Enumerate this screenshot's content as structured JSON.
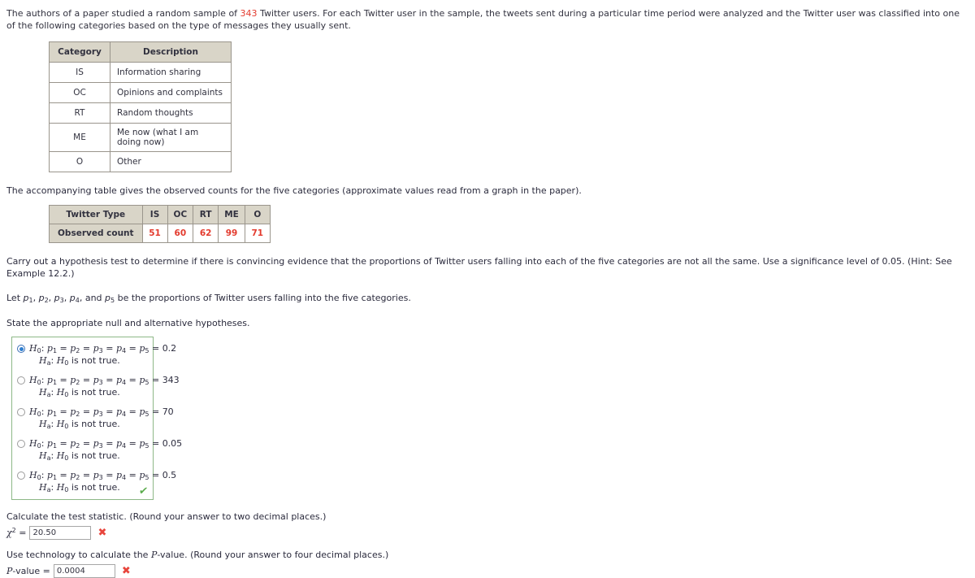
{
  "intro": {
    "part1": "The authors of a paper studied a random sample of ",
    "sample_size": "343",
    "part2": " Twitter users. For each Twitter user in the sample, the tweets sent during a particular time period were analyzed and the Twitter user was classified into one of the following categories based on the type of messages they usually sent."
  },
  "category_table": {
    "headers": [
      "Category",
      "Description"
    ],
    "rows": [
      {
        "category": "IS",
        "description": "Information sharing"
      },
      {
        "category": "OC",
        "description": "Opinions and complaints"
      },
      {
        "category": "RT",
        "description": "Random thoughts"
      },
      {
        "category": "ME",
        "description": "Me now (what I am doing now)"
      },
      {
        "category": "O",
        "description": "Other"
      }
    ]
  },
  "accompanying_text": "The accompanying table gives the observed counts for the five categories (approximate values read from a graph in the paper).",
  "counts_table": {
    "row_header_1": "Twitter Type",
    "row_header_2": "Observed count",
    "columns": [
      "IS",
      "OC",
      "RT",
      "ME",
      "O"
    ],
    "values": [
      "51",
      "60",
      "62",
      "99",
      "71"
    ]
  },
  "instruction": "Carry out a hypothesis test to determine if there is convincing evidence that the proportions of Twitter users falling into each of the five categories are not all the same. Use a significance level of 0.05. (Hint: See Example 12.2.)",
  "let_line": {
    "prefix": "Let ",
    "p1": "p",
    "s1": "1",
    "p2": "p",
    "s2": "2",
    "p3": "p",
    "s3": "3",
    "p4": "p",
    "s4": "4",
    "and": " and ",
    "p5": "p",
    "s5": "5",
    "suffix": " be the proportions of Twitter users falling into the five categories."
  },
  "state_hypotheses": "State the appropriate null and alternative hypotheses.",
  "hypothesis_options": [
    {
      "value": "0.2",
      "selected": true,
      "alt": "is not true."
    },
    {
      "value": "343",
      "selected": false,
      "alt": "is not true."
    },
    {
      "value": "70",
      "selected": false,
      "alt": "is not true."
    },
    {
      "value": "0.05",
      "selected": false,
      "alt": "is not true."
    },
    {
      "value": "0.5",
      "selected": false,
      "alt": "is not true."
    }
  ],
  "hypothesis_template": {
    "null_prefix": "H",
    "null_sub": "0",
    "null_body": ": p1 = p2 = p3 = p4 = p5 = ",
    "alt_prefix": "H",
    "alt_sub": "a",
    "alt_body": ": H0 "
  },
  "group_feedback": {
    "icon": "check-icon",
    "glyph": "✔",
    "color": "#5aab4c"
  },
  "test_statistic": {
    "prompt": "Calculate the test statistic. (Round your answer to two decimal places.)",
    "label_symbol": "χ",
    "label_exponent": "2",
    "equals": " = ",
    "value": "20.50",
    "feedback_glyph": "✖",
    "feedback_color": "#e8453c"
  },
  "p_value": {
    "prompt_part1": "Use technology to calculate the ",
    "prompt_italic": "P",
    "prompt_part2": "-value. (Round your answer to four decimal places.)",
    "label_italic": "P",
    "label_rest": "-value = ",
    "value": "0.0004",
    "feedback_glyph": "✖",
    "feedback_color": "#e8453c"
  },
  "colors": {
    "answer_red": "#e33b2e",
    "table_header_bg": "#d9d5c8",
    "table_border": "#9a958c",
    "group_border": "#8db887",
    "radio_selected": "#2f7fd0"
  }
}
